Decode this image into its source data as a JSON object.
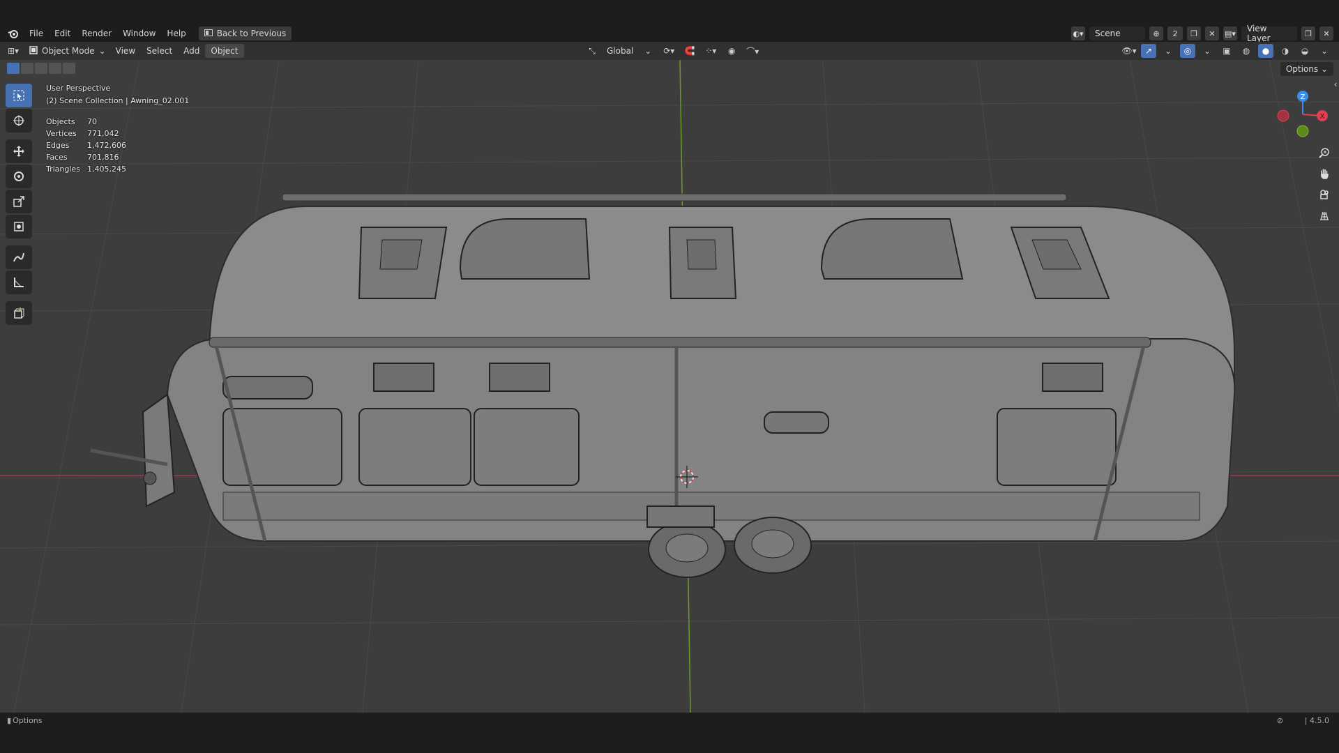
{
  "menubar": {
    "items": [
      "File",
      "Edit",
      "Render",
      "Window",
      "Help"
    ],
    "back_button": "Back to Previous",
    "scene": "Scene",
    "scene_users": "2",
    "view_layer": "View Layer"
  },
  "header": {
    "mode": "Object Mode",
    "menus": [
      "View",
      "Select",
      "Add",
      "Object"
    ],
    "orientation": "Global",
    "options": "Options"
  },
  "overlay": {
    "perspective": "User Perspective",
    "collection": "(2) Scene Collection | Awning_02.001",
    "stats": [
      {
        "label": "Objects",
        "value": "70"
      },
      {
        "label": "Vertices",
        "value": "771,042"
      },
      {
        "label": "Edges",
        "value": "1,472,606"
      },
      {
        "label": "Faces",
        "value": "701,816"
      },
      {
        "label": "Triangles",
        "value": "1,405,245"
      }
    ]
  },
  "gizmo": {
    "z": "Z",
    "x": "X"
  },
  "statusbar": {
    "left": "Options",
    "version": "4.5.0"
  },
  "colors": {
    "accent": "#4772b3",
    "x_axis": "#e0404f",
    "y_axis": "#7fb32a",
    "z_axis": "#3b8ee8",
    "viewport_bg": "#3d3d3d"
  }
}
